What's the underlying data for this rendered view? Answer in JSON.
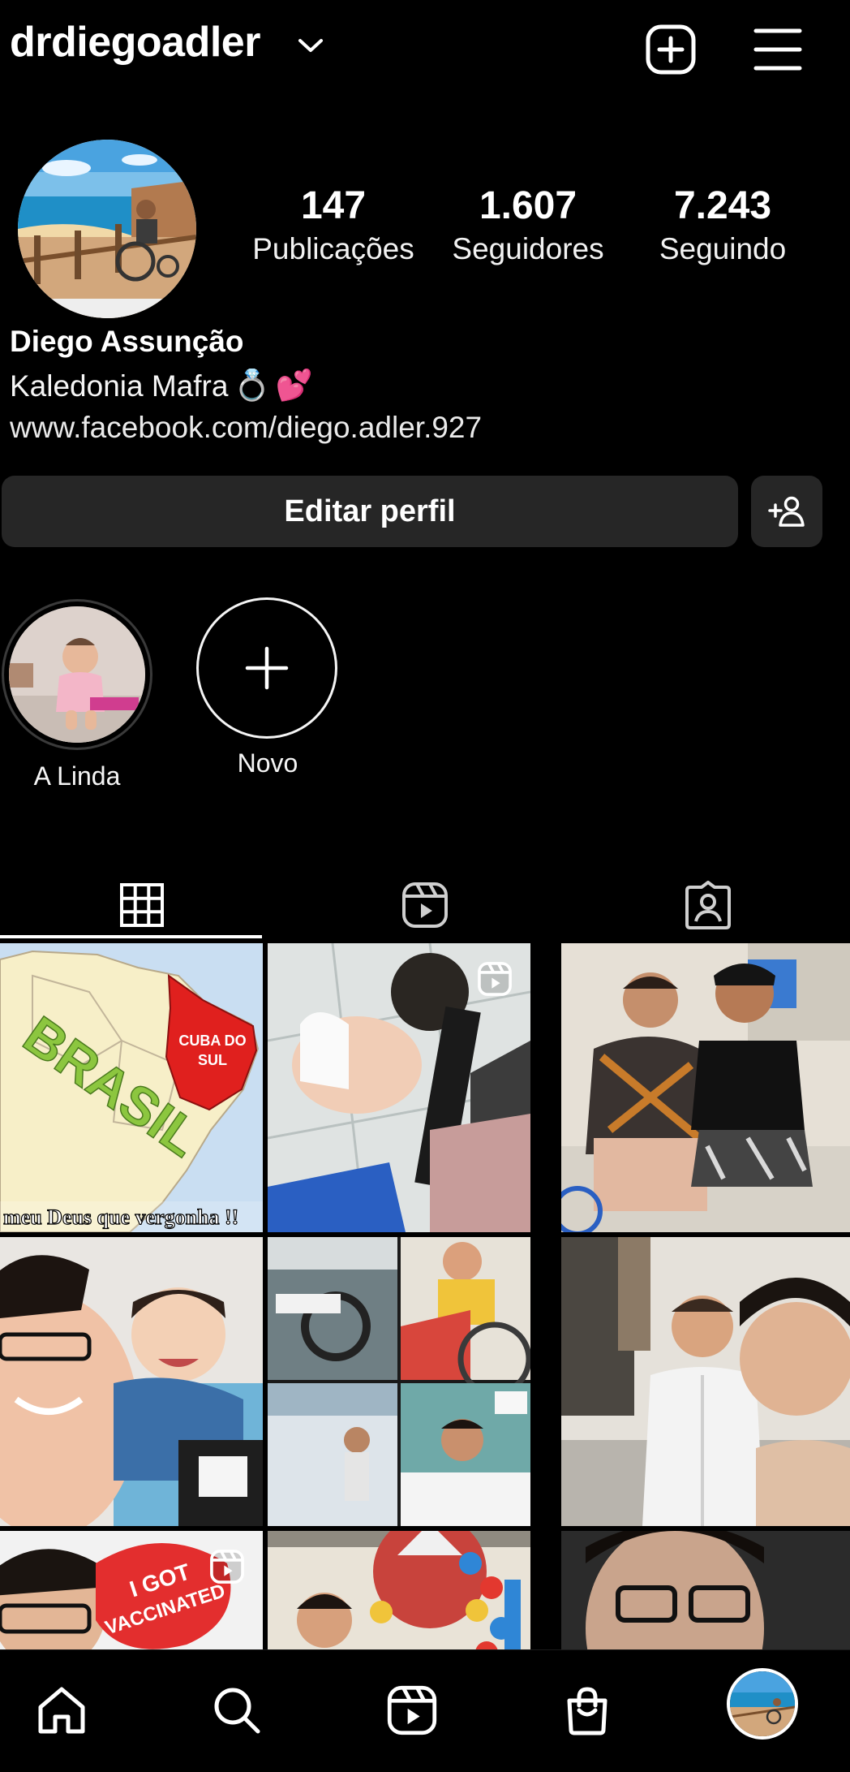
{
  "header": {
    "username": "drdiegoadler",
    "chevron_icon": "chevron-down-icon",
    "add_icon": "add-post-icon",
    "menu_icon": "hamburger-menu-icon"
  },
  "profile": {
    "avatar": "profile-photo",
    "stats": [
      {
        "value": "147",
        "label": "Publicações"
      },
      {
        "value": "1.607",
        "label": "Seguidores"
      },
      {
        "value": "7.243",
        "label": "Seguindo"
      }
    ],
    "name": "Diego Assunção",
    "bio_line": "Kaledonia Mafra",
    "bio_emojis": [
      "💍",
      "💕"
    ],
    "link": "www.facebook.com/diego.adler.927"
  },
  "actions": {
    "edit_label": "Editar perfil",
    "suggest_icon": "add-person-icon"
  },
  "highlights": [
    {
      "label": "A Linda"
    },
    {
      "label": "Novo"
    }
  ],
  "tabs": [
    {
      "name": "grid",
      "icon": "grid-icon",
      "active": true
    },
    {
      "name": "reels",
      "icon": "reels-icon",
      "active": false
    },
    {
      "name": "tagged",
      "icon": "tagged-icon",
      "active": false
    }
  ],
  "grid_posts": [
    {
      "overlay_text_1": "BRASIL",
      "overlay_text_2": "CUBA DO",
      "overlay_text_3": "SUL",
      "caption": "meu Deus que vergonha !!"
    },
    {
      "reel": true
    },
    {},
    {},
    {},
    {},
    {
      "reel": true,
      "sticker_text_1": "I GOT",
      "sticker_text_2": "VACCINATED"
    },
    {},
    {}
  ],
  "bottom_nav": [
    "home-icon",
    "search-icon",
    "reels-icon",
    "shop-icon",
    "profile-avatar"
  ],
  "colors": {
    "background": "#000000",
    "button": "#262626",
    "text": "#f5f5f5"
  }
}
